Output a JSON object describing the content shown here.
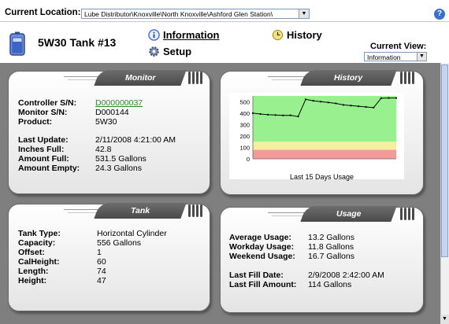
{
  "location": {
    "label": "Current Location:",
    "value": "Lube Distributor\\Knoxville\\North Knoxville\\Ashford Glen Station\\"
  },
  "header": {
    "tank_title": "5W30 Tank #13",
    "nav": {
      "information": "Information",
      "setup": "Setup",
      "history": "History"
    },
    "current_view_label": "Current View:",
    "current_view_value": "Information"
  },
  "monitor": {
    "title": "Monitor",
    "controller_sn_label": "Controller S/N:",
    "controller_sn": "D000000037",
    "monitor_sn_label": "Monitor S/N:",
    "monitor_sn": "D000144",
    "product_label": "Product:",
    "product": "5W30",
    "last_update_label": "Last Update:",
    "last_update": "2/11/2008 4:21:00 AM",
    "inches_full_label": "Inches Full:",
    "inches_full": "42.8",
    "amount_full_label": "Amount Full:",
    "amount_full": "531.5 Gallons",
    "amount_empty_label": "Amount Empty:",
    "amount_empty": "24.3 Gallons"
  },
  "history": {
    "title": "History",
    "caption": "Last 15 Days Usage",
    "chart_data": {
      "type": "line",
      "x": [
        1,
        2,
        3,
        4,
        5,
        6,
        7,
        8,
        9,
        10,
        11,
        12,
        13,
        14,
        15,
        16,
        17,
        18,
        19,
        20
      ],
      "values": [
        400,
        392,
        386,
        383,
        380,
        381,
        370,
        520,
        508,
        500,
        493,
        485,
        472,
        466,
        460,
        454,
        448,
        530,
        532,
        532
      ],
      "ylim": [
        0,
        550
      ],
      "yticks": [
        0,
        100,
        200,
        300,
        400,
        500
      ],
      "bands": [
        {
          "from": 0,
          "to": 80,
          "color": "#f59a9a"
        },
        {
          "from": 80,
          "to": 150,
          "color": "#f5f0a0"
        },
        {
          "from": 150,
          "to": 550,
          "color": "#98f08e"
        }
      ],
      "line_color": "#000000"
    }
  },
  "tank": {
    "title": "Tank",
    "tank_type_label": "Tank Type:",
    "tank_type": "Horizontal Cylinder",
    "capacity_label": "Capacity:",
    "capacity": "556 Gallons",
    "offset_label": "Offset:",
    "offset": "1",
    "calheight_label": "CalHeight:",
    "calheight": "60",
    "length_label": "Length:",
    "length": "74",
    "height_label": "Height:",
    "height": "47"
  },
  "usage": {
    "title": "Usage",
    "average_label": "Average Usage:",
    "average": "13.2 Gallons",
    "workday_label": "Workday Usage:",
    "workday": "11.8 Gallons",
    "weekend_label": "Weekend Usage:",
    "weekend": "16.7 Gallons",
    "last_fill_date_label": "Last Fill Date:",
    "last_fill_date": "2/9/2008 2:42:00 AM",
    "last_fill_amount_label": "Last Fill Amount:",
    "last_fill_amount": "114 Gallons"
  },
  "colors": {
    "link": "#2d8a2d",
    "panel_tab": "#555555",
    "background": "#7f7f7f"
  },
  "icons": [
    "tank-icon",
    "info-icon",
    "gear-icon",
    "history-icon",
    "help-icon"
  ]
}
